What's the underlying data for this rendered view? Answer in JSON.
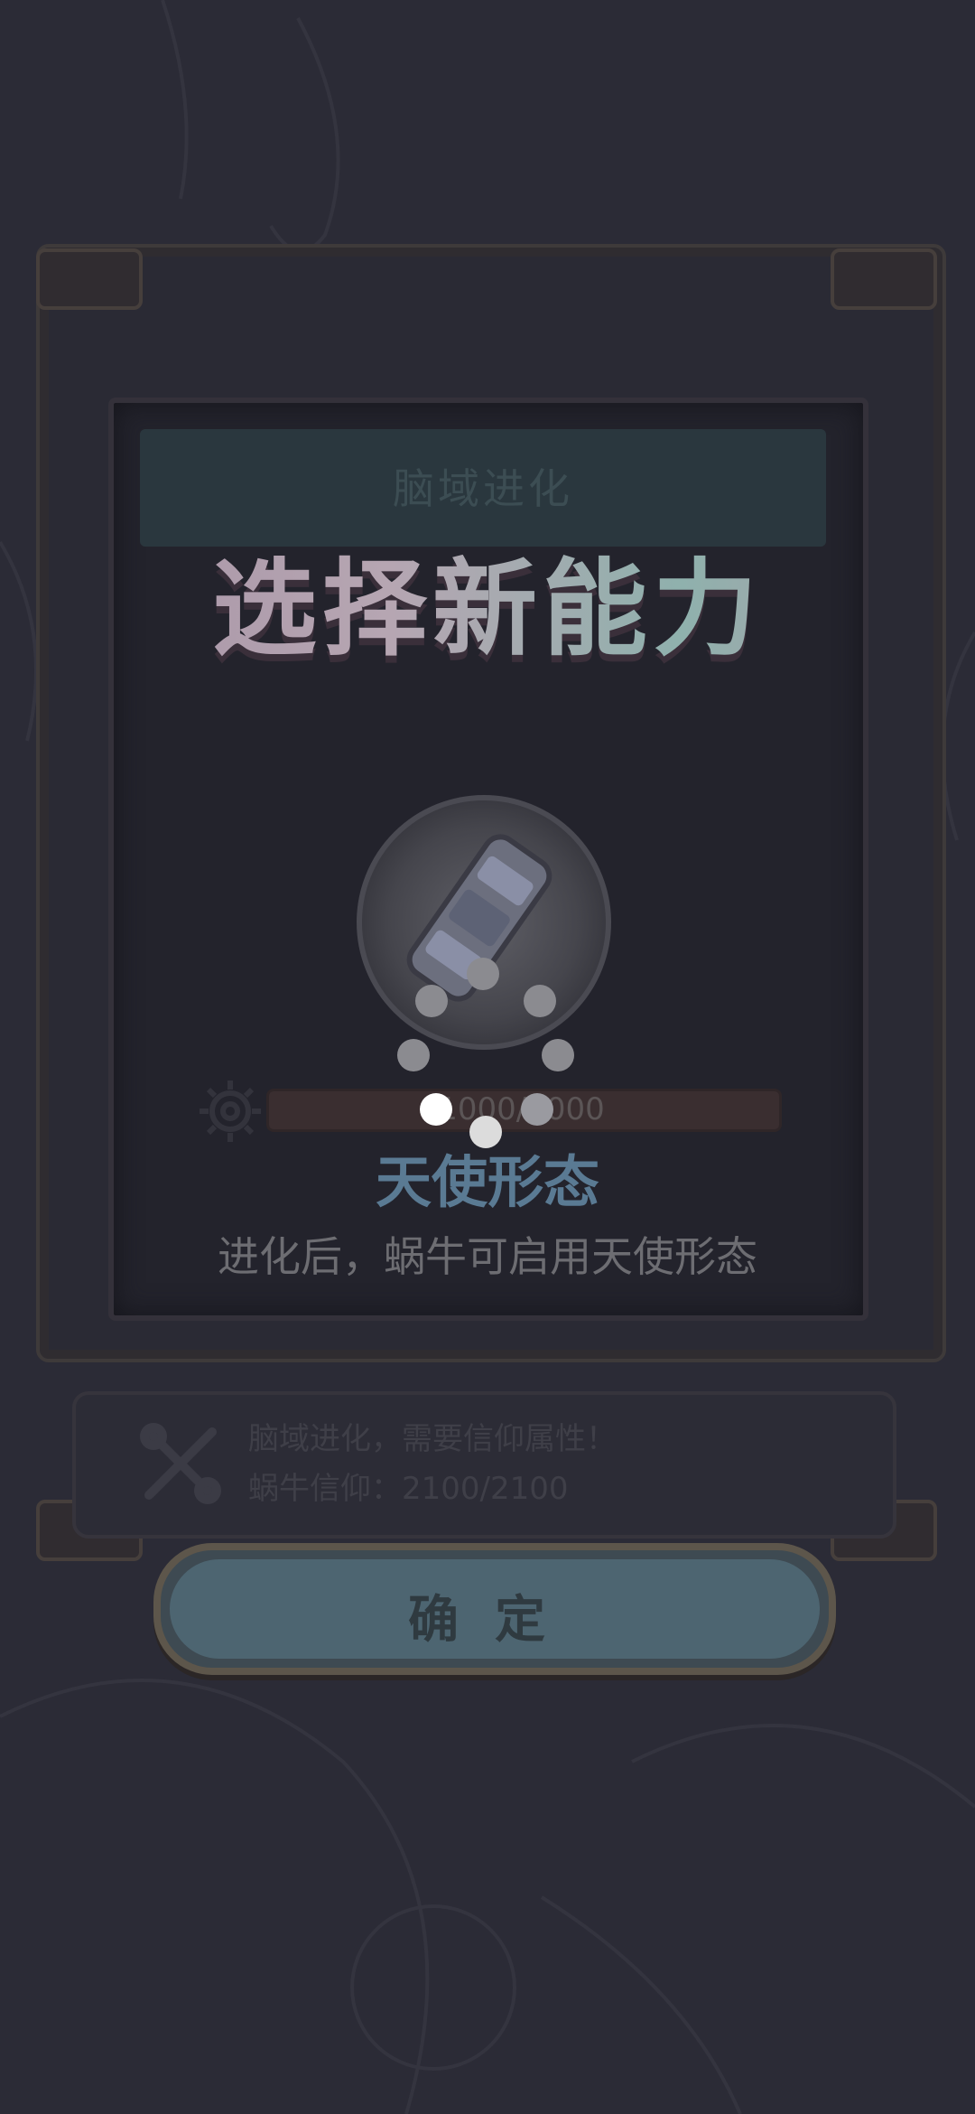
{
  "header": {
    "title": "脑域进化"
  },
  "main_title": "选择新能力",
  "progress": {
    "text": "1000/4000"
  },
  "ability": {
    "name": "天使形态",
    "description": "进化后，蜗牛可启用天使形态"
  },
  "info": {
    "line1": "脑域进化，需要信仰属性！",
    "line2": "蜗牛信仰：2100/2100"
  },
  "confirm_button": {
    "label": "确定"
  },
  "colors": {
    "accent_blue": "#5a7a93",
    "button_teal": "#4d6571"
  },
  "icons": [
    "gear-icon",
    "angel-form-emblem-icon",
    "wrench-icon",
    "loading-spinner-icon"
  ]
}
